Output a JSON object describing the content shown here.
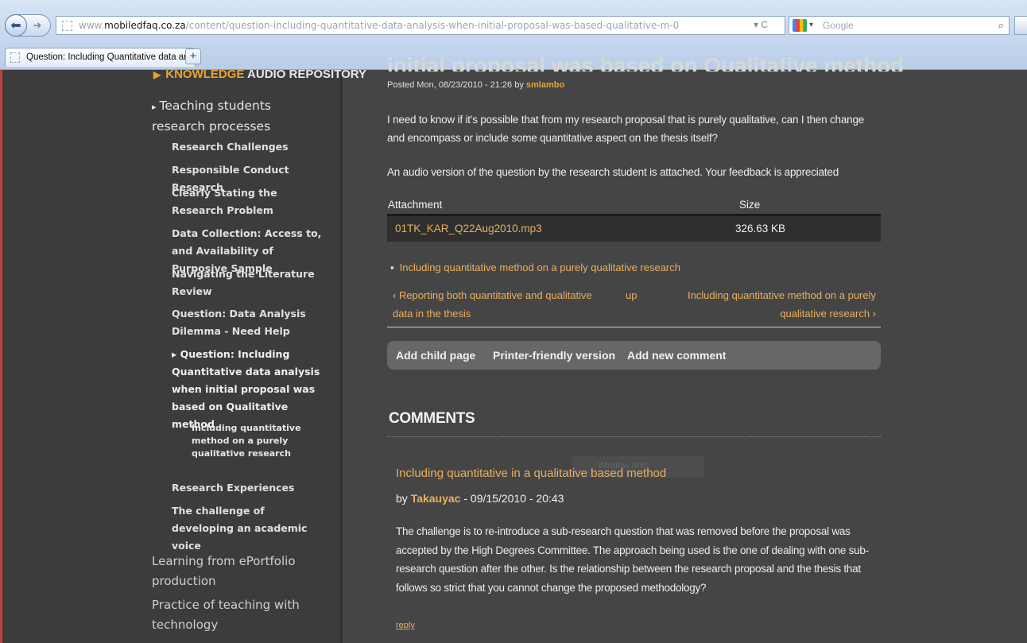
{
  "browser": {
    "url_prefix": "www.",
    "url_domain": "mobiledfaq.co.za",
    "url_path": "/content/question-including-quantitative-data-analysis-when-initial-proposal-was-based-qualitative-m-0",
    "url_controls": "▾  C",
    "search_placeholder": "Google",
    "tab_title": "Question: Including Quantitative data an...",
    "new_tab": "+"
  },
  "sidebar": {
    "top_prefix": "KNOWLEDGE",
    "top_suffix": "AUDIO REPOSITORY",
    "section": "Teaching students research processes",
    "items": [
      "Research Challenges",
      "Responsible Conduct Research",
      "Clearly Stating the Research Problem",
      "Data Collection: Access to, and Availability of Purposive Sample",
      "Navigating the Literature Review",
      "Question: Data Analysis Dilemma - Need Help"
    ],
    "active_item": "Question: Including Quantitative data analysis when initial proposal was based on Qualitative method",
    "active_child": "Including quantitative method on a purely qualitative research",
    "items_after": [
      "Research Experiences",
      "The challenge of developing an academic voice"
    ],
    "bottom": [
      "Learning from ePortfolio production",
      "Practice of teaching with technology"
    ]
  },
  "article": {
    "title_fragment": "initial proposal was based on Qualitative method",
    "posted_prefix": "Posted Mon, 08/23/2010 - 21:26 by",
    "author": "smlambo",
    "body_1": "I need to know if it's possible that from my research proposal that is purely qualitative, can I then change and encompass or include some quantitative aspect on the thesis itself?",
    "body_2": "An audio version of the question by the research student is attached. Your feedback is appreciated",
    "attachments": {
      "col_attachment": "Attachment",
      "col_size": "Size",
      "file": "01TK_KAR_Q22Aug2010.mp3",
      "size": "326.63 KB"
    },
    "child_link": "Including quantitative method on a purely qualitative research",
    "pager": {
      "prev": "‹ Reporting both quantitative and qualitative data in the thesis",
      "up": "up",
      "next": "Including quantitative method on a purely qualitative research ›"
    },
    "links": {
      "add_child": "Add child page",
      "printer": "Printer-friendly version",
      "add_comment": "Add new comment"
    }
  },
  "comments": {
    "heading": "COMMENTS",
    "overlay_text": "Window Snip",
    "items": [
      {
        "title": "Including quantitative in a qualitative based method",
        "by_prefix": "by",
        "user": "Takauyac",
        "date": "- 09/15/2010 - 20:43",
        "body": "The challenge is to re-introduce a sub-research question that was removed before the proposal was accepted by the High Degrees Committee. The approach being used is the one of dealing with one sub-research question after the other. Is the relationship between the research proposal and the thesis that follows so strict that you cannot change the proposed methodology?",
        "reply": "reply"
      }
    ]
  },
  "colors": {
    "accent": "#e8a530",
    "link": "#e8b060",
    "page_bg": "#454545",
    "sidebar_bg": "#3c3c3c"
  }
}
